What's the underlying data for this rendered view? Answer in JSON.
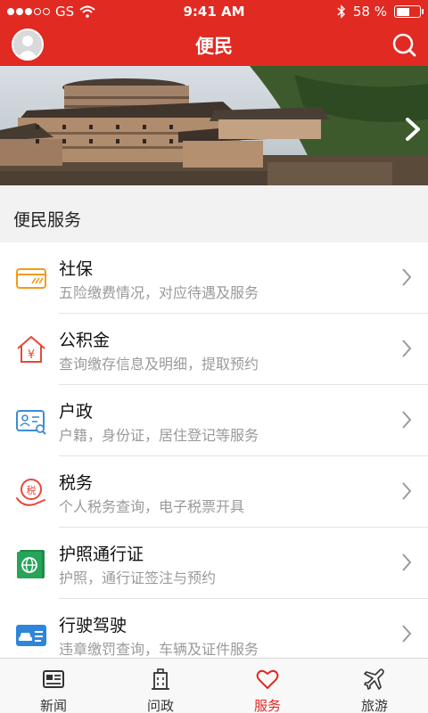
{
  "status_bar": {
    "carrier": "GS",
    "time": "9:41 AM",
    "battery": "58 %",
    "battery_level": 0.58,
    "signal_bars": 3,
    "signal_total": 5
  },
  "header": {
    "title": "便民",
    "avatar_icon": "avatar-icon",
    "search_icon": "search-icon"
  },
  "banner": {
    "image": "tulou-village-photo",
    "next_icon": "chevron-right-icon"
  },
  "section": {
    "title": "便民服务"
  },
  "services": [
    {
      "icon": "card-icon",
      "title": "社保",
      "subtitle": "五险缴费情况，对应待遇及服务"
    },
    {
      "icon": "house-yuan-icon",
      "title": "公积金",
      "subtitle": "查询缴存信息及明细，提取预约"
    },
    {
      "icon": "id-card-search-icon",
      "title": "户政",
      "subtitle": "户籍，身份证，居住登记等服务"
    },
    {
      "icon": "tax-hand-icon",
      "title": "税务",
      "subtitle": "个人税务查询，电子税票开具"
    },
    {
      "icon": "passport-globe-icon",
      "title": "护照通行证",
      "subtitle": "护照，通行证签注与预约"
    },
    {
      "icon": "car-license-icon",
      "title": "行驶驾驶",
      "subtitle": "违章缴罚查询，车辆及证件服务"
    }
  ],
  "tabs": [
    {
      "icon": "news-icon",
      "label": "新闻",
      "active": false
    },
    {
      "icon": "government-building-icon",
      "label": "问政",
      "active": false
    },
    {
      "icon": "heart-icon",
      "label": "服务",
      "active": true
    },
    {
      "icon": "airplane-icon",
      "label": "旅游",
      "active": false
    }
  ],
  "colors": {
    "brand_red": "#e02a22",
    "card_orange": "#f39a1e",
    "home_red": "#e8473a",
    "id_blue": "#3d8bd6",
    "passport_green": "#27a35a",
    "car_blue": "#2f86d8"
  }
}
